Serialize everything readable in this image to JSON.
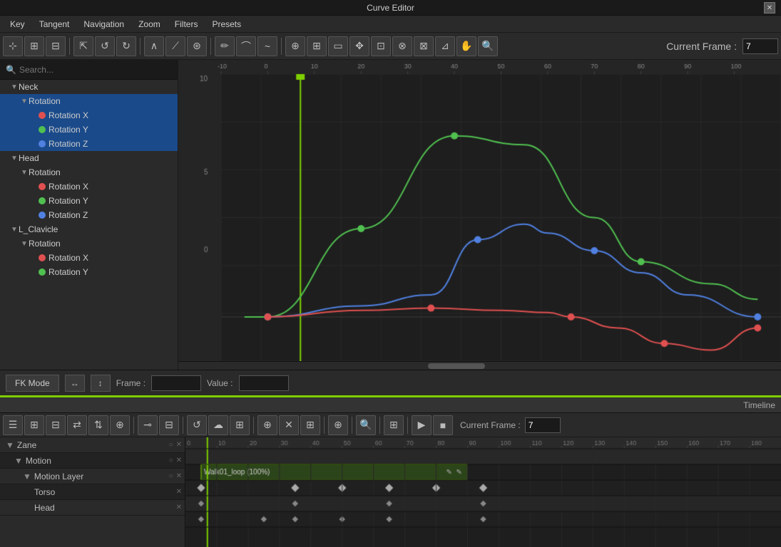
{
  "titleBar": {
    "title": "Curve Editor"
  },
  "menuBar": {
    "items": [
      "Key",
      "Tangent",
      "Navigation",
      "Zoom",
      "Filters",
      "Presets"
    ]
  },
  "toolbar": {
    "currentFrameLabel": "Current Frame :",
    "currentFrameValue": "7",
    "buttons": [
      "⟳",
      "⊞",
      "⊟",
      "↗",
      "↙",
      "↺",
      "↻",
      "⤢",
      "⤣",
      "~",
      "⇄",
      "⊕",
      "⊞",
      "⊡",
      "✥",
      "⊞",
      "⊡",
      "✦",
      "⊛",
      "☰",
      "☁",
      "🔍"
    ]
  },
  "search": {
    "placeholder": "Search..."
  },
  "hierarchy": {
    "items": [
      {
        "level": 1,
        "type": "group",
        "arrow": "▼",
        "label": "Neck",
        "dot": null
      },
      {
        "level": 2,
        "type": "group",
        "arrow": "▼",
        "label": "Rotation",
        "dot": null,
        "selected": true
      },
      {
        "level": 3,
        "type": "leaf",
        "label": "Rotation X",
        "dot": "red",
        "selected": true
      },
      {
        "level": 3,
        "type": "leaf",
        "label": "Rotation Y",
        "dot": "green",
        "selected": true
      },
      {
        "level": 3,
        "type": "leaf",
        "label": "Rotation Z",
        "dot": "blue",
        "selected": true
      },
      {
        "level": 1,
        "type": "group",
        "arrow": "▼",
        "label": "Head",
        "dot": null
      },
      {
        "level": 2,
        "type": "group",
        "arrow": "▼",
        "label": "Rotation",
        "dot": null
      },
      {
        "level": 3,
        "type": "leaf",
        "label": "Rotation X",
        "dot": "red"
      },
      {
        "level": 3,
        "type": "leaf",
        "label": "Rotation Y",
        "dot": "green"
      },
      {
        "level": 3,
        "type": "leaf",
        "label": "Rotation Z",
        "dot": "blue"
      },
      {
        "level": 1,
        "type": "group",
        "arrow": "▼",
        "label": "L_Clavicle",
        "dot": null
      },
      {
        "level": 2,
        "type": "group",
        "arrow": "▼",
        "label": "Rotation",
        "dot": null
      },
      {
        "level": 3,
        "type": "leaf",
        "label": "Rotation X",
        "dot": "red"
      },
      {
        "level": 3,
        "type": "leaf",
        "label": "Rotation Y",
        "dot": "green"
      }
    ]
  },
  "bottomControls": {
    "fkModeLabel": "FK Mode",
    "frameLabel": "Frame :",
    "valueLabel": "Value :"
  },
  "timeline": {
    "title": "Timeline",
    "currentFrame": "7",
    "motionClipLabel": "Walk01_loop (100%)",
    "rows": [
      {
        "label": "Zane",
        "level": 0,
        "hasExpand": true,
        "hasClose": true
      },
      {
        "label": "Motion",
        "level": 1,
        "hasExpand": true,
        "hasClose": true
      },
      {
        "label": "Motion Layer",
        "level": 2,
        "hasExpand": true,
        "hasClose": true
      },
      {
        "label": "Torso",
        "level": 3,
        "hasExpand": false,
        "hasClose": true
      },
      {
        "label": "Head",
        "level": 3,
        "hasExpand": false,
        "hasClose": true
      }
    ]
  }
}
